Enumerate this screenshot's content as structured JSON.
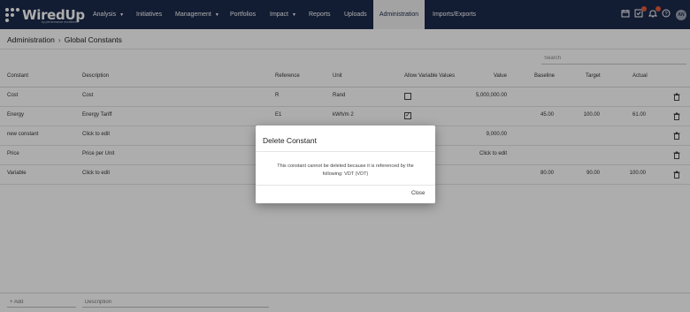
{
  "brand": {
    "name": "WiredUp",
    "tagline": "by performance excellence"
  },
  "nav": {
    "items": [
      {
        "label": "Analysis",
        "dropdown": true
      },
      {
        "label": "Initiatives",
        "dropdown": false
      },
      {
        "label": "Management",
        "dropdown": true
      },
      {
        "label": "Portfolios",
        "dropdown": false
      },
      {
        "label": "Impact",
        "dropdown": true
      },
      {
        "label": "Reports",
        "dropdown": false
      },
      {
        "label": "Uploads",
        "dropdown": false
      },
      {
        "label": "Administration",
        "dropdown": false,
        "active": true
      },
      {
        "label": "Imports/Exports",
        "dropdown": false
      }
    ],
    "icons": [
      "calendar-icon",
      "tasks-icon",
      "bell-icon",
      "help-icon"
    ],
    "user_initials": "AN",
    "colors": {
      "navbar": "#1b2a4a",
      "badge": "#e55a3c"
    }
  },
  "breadcrumb": {
    "root": "Administration",
    "current": "Global Constants"
  },
  "search": {
    "placeholder": "Search",
    "value": ""
  },
  "table": {
    "headers": {
      "constant": "Constant",
      "description": "Description",
      "reference": "Reference",
      "unit": "Unit",
      "allow_variable": "Allow Variable Values",
      "value": "Value",
      "baseline": "Baseline",
      "target": "Target",
      "actual": "Actual"
    },
    "rows": [
      {
        "constant": "Cost",
        "description": "Cost",
        "reference": "R",
        "unit": "Rand",
        "allow_variable": false,
        "value": "5,000,000.00",
        "baseline": "",
        "target": "",
        "actual": ""
      },
      {
        "constant": "Energy",
        "description": "Energy Tariff",
        "reference": "E1",
        "unit": "kWh/m 2",
        "allow_variable": true,
        "value": "",
        "baseline": "45.00",
        "target": "100.00",
        "actual": "61.00"
      },
      {
        "constant": "new constant",
        "description": "Click to edit",
        "reference": "",
        "unit": "",
        "allow_variable": null,
        "value": "9,000.00",
        "baseline": "",
        "target": "",
        "actual": ""
      },
      {
        "constant": "Price",
        "description": "Price per Unit",
        "reference": "",
        "unit": "",
        "allow_variable": null,
        "value": "Click to edit",
        "baseline": "",
        "target": "",
        "actual": ""
      },
      {
        "constant": "Variable",
        "description": "Click to edit",
        "reference": "",
        "unit": "",
        "allow_variable": null,
        "value": "",
        "baseline": "80.00",
        "target": "90.00",
        "actual": "100.00"
      }
    ]
  },
  "footer": {
    "add_placeholder": "+ Add",
    "description_placeholder": "Description"
  },
  "modal": {
    "title": "Delete Constant",
    "message": "This constant cannot be deleted because it is referenced by the following: VDT (VDT)",
    "close_label": "Close"
  }
}
